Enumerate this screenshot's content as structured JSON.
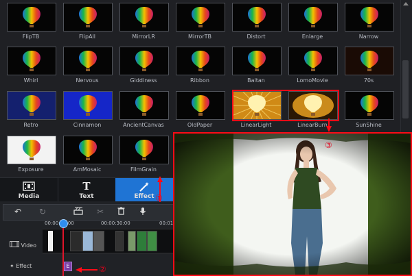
{
  "effects": [
    {
      "label": "FlipTB",
      "style": "dark"
    },
    {
      "label": "FlipAll",
      "style": "dark"
    },
    {
      "label": "MirrorLR",
      "style": "dark"
    },
    {
      "label": "MirrorTB",
      "style": "dark"
    },
    {
      "label": "Distort",
      "style": "dark"
    },
    {
      "label": "Enlarge",
      "style": "dark"
    },
    {
      "label": "Narrow",
      "style": "dark"
    },
    {
      "label": "Whirl",
      "style": "dark"
    },
    {
      "label": "Nervous",
      "style": "dark"
    },
    {
      "label": "Giddiness",
      "style": "dark"
    },
    {
      "label": "Ribbon",
      "style": "dark"
    },
    {
      "label": "Baltan",
      "style": "dark"
    },
    {
      "label": "LomoMovie",
      "style": "dark"
    },
    {
      "label": "70s",
      "style": "warm"
    },
    {
      "label": "Retro",
      "style": "navy"
    },
    {
      "label": "Cinnamon",
      "style": "blue"
    },
    {
      "label": "AncientCanvas",
      "style": "dark"
    },
    {
      "label": "OldPaper",
      "style": "dark"
    },
    {
      "label": "LinearLight",
      "style": "sun"
    },
    {
      "label": "LinearBurn",
      "style": "burn"
    },
    {
      "label": "SunShine",
      "style": "dark"
    },
    {
      "label": "Exposure",
      "style": "light"
    },
    {
      "label": "AmMosaic",
      "style": "dark"
    },
    {
      "label": "FilmGrain",
      "style": "dark"
    }
  ],
  "tabs": [
    {
      "label": "Media",
      "icon": "film-icon"
    },
    {
      "label": "Text",
      "icon": "text-icon"
    },
    {
      "label": "Effect",
      "icon": "magic-wand-icon"
    }
  ],
  "timeline": {
    "ruler": [
      "00:00:00:00",
      "00:00:30:00",
      "00:01"
    ],
    "tracks": [
      "Video",
      "Effect"
    ],
    "effect_chip": "E"
  },
  "annotations": [
    "①",
    "②",
    "③"
  ],
  "colors": {
    "accent": "#1f74d4",
    "annotation": "#e3001a",
    "preview_bg": "#3e5b1d"
  }
}
